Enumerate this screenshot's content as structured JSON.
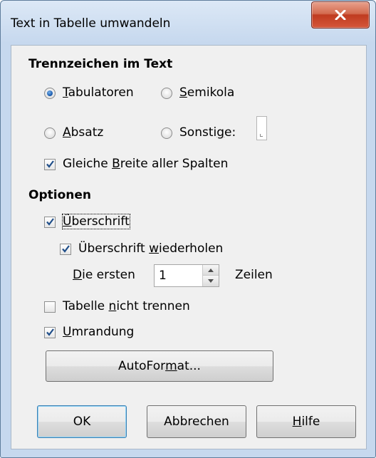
{
  "window": {
    "title": "Text in Tabelle umwandeln"
  },
  "separators": {
    "heading": "Trennzeichen im Text",
    "tabs": {
      "pre": "",
      "accel": "T",
      "post": "abulatoren",
      "checked": true
    },
    "semicolons": {
      "pre": "",
      "accel": "S",
      "post": "emikola",
      "checked": false
    },
    "paragraph": {
      "pre": "",
      "accel": "A",
      "post": "bsatz",
      "checked": false
    },
    "other": {
      "pre": "Sonsti",
      "accel": "g",
      "post": "e:",
      "checked": false,
      "value": ""
    },
    "equal_width": {
      "pre": "Gleiche ",
      "accel": "B",
      "post": "reite aller Spalten",
      "checked": true
    }
  },
  "options": {
    "heading": "Optionen",
    "heading_cb": {
      "pre": "",
      "accel": "Ü",
      "post": "berschrift",
      "checked": true
    },
    "repeat_heading": {
      "pre": "Überschrift ",
      "accel": "w",
      "post": "iederholen",
      "checked": true
    },
    "first_rows": {
      "pre": "",
      "accel": "D",
      "post": "ie ersten",
      "value": "1",
      "suffix": "Zeilen"
    },
    "dont_split": {
      "pre": "Tabelle ",
      "accel": "n",
      "post": "icht trennen",
      "checked": false
    },
    "border": {
      "pre": "",
      "accel": "U",
      "post": "mrandung",
      "checked": true
    },
    "autoformat": {
      "pre": "AutoFor",
      "accel": "m",
      "post": "at..."
    }
  },
  "buttons": {
    "ok": "OK",
    "cancel": "Abbrechen",
    "help": {
      "pre": "",
      "accel": "H",
      "post": "ilfe"
    }
  }
}
